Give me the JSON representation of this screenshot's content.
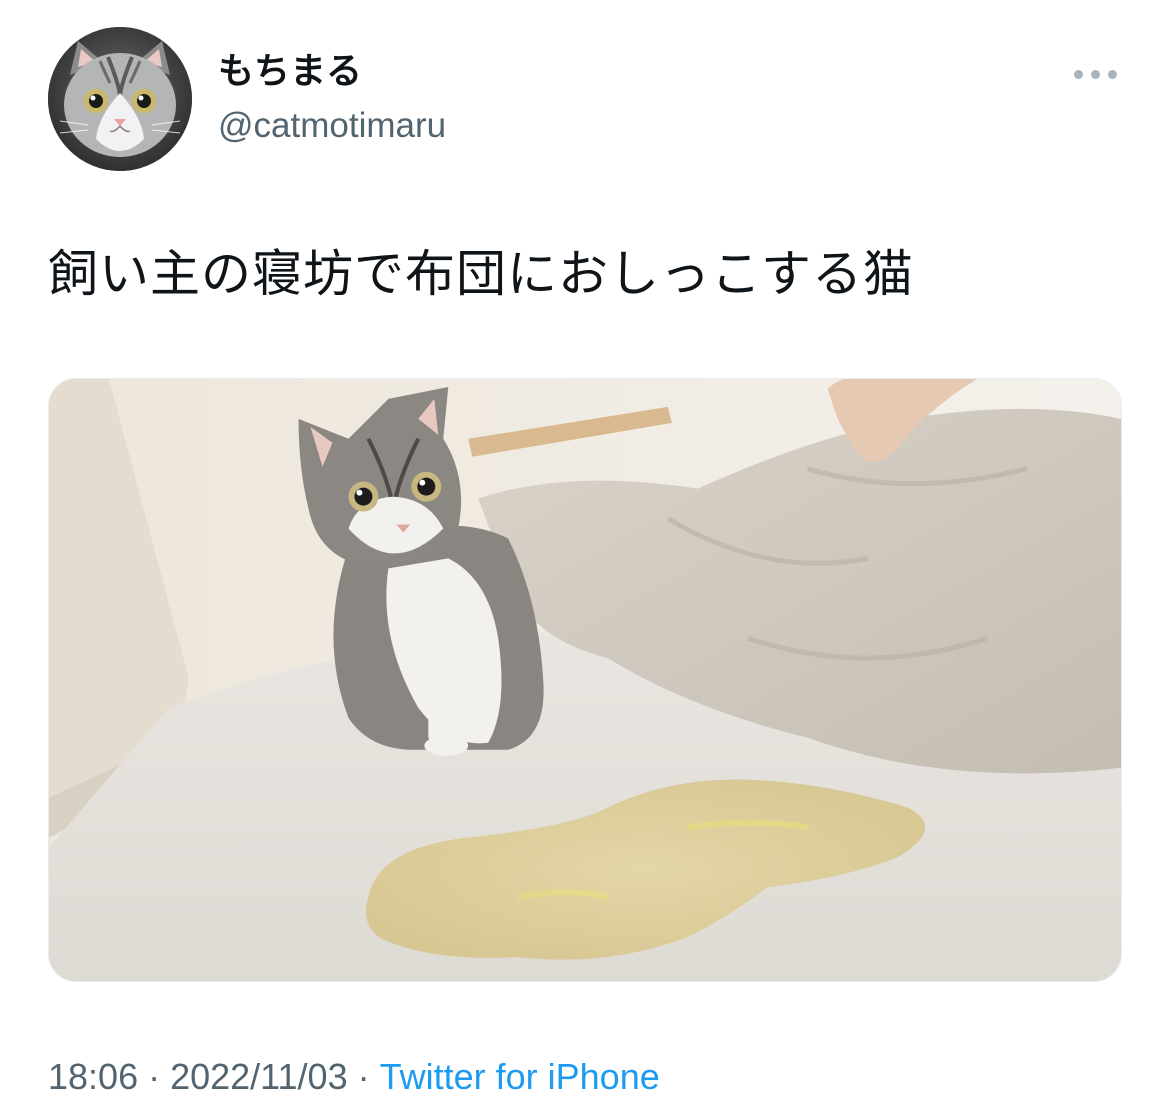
{
  "author": {
    "display_name": "もちまる",
    "username": "@catmotimaru"
  },
  "tweet": {
    "text": "飼い主の寝坊で布団におしっこする猫",
    "time": "18:06",
    "separator": "·",
    "date": "2022/11/03",
    "source": "Twitter for iPhone"
  },
  "icons": {
    "more": "more-horizontal-icon"
  },
  "colors": {
    "primary_text": "#0f1419",
    "secondary_text": "#536471",
    "link": "#1d9bf0",
    "background": "#ffffff"
  }
}
